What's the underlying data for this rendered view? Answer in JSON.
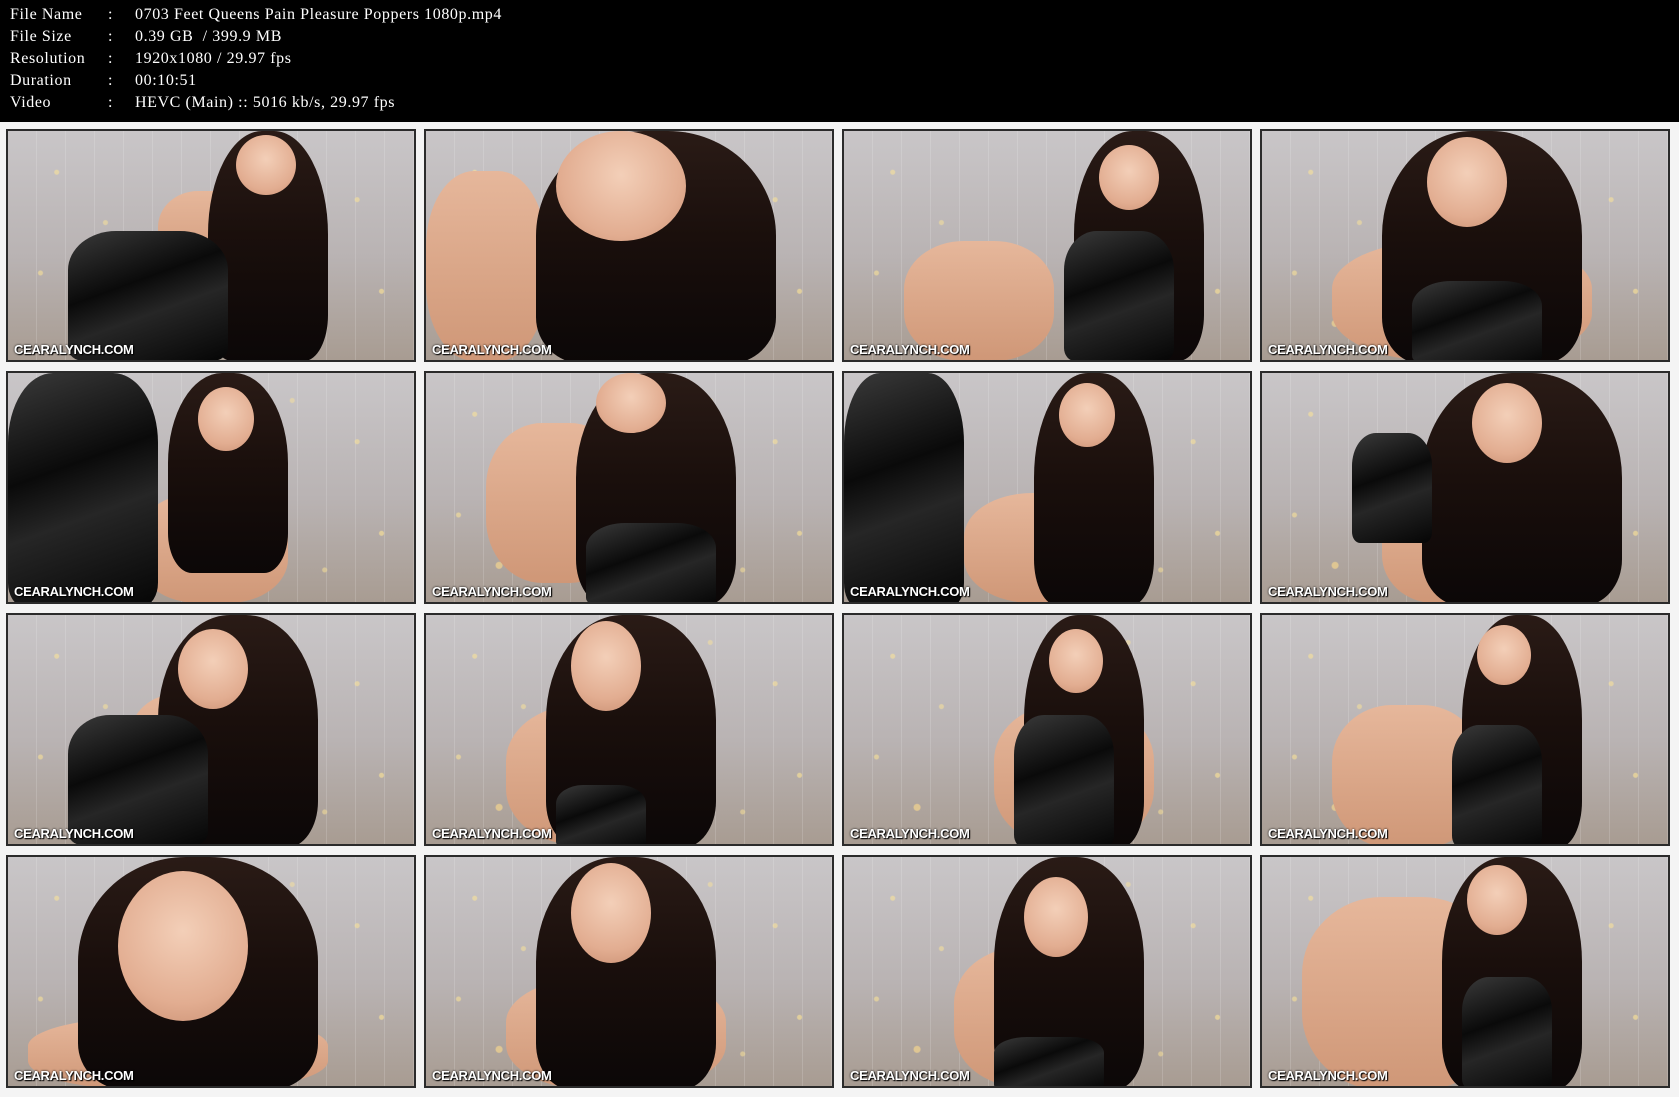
{
  "info": {
    "rows": [
      {
        "key": "File Name",
        "sep": ":",
        "value": "0703 Feet Queens Pain Pleasure Poppers 1080p.mp4"
      },
      {
        "key": "File Size",
        "sep": ":",
        "value": "0.39 GB  / 399.9 MB"
      },
      {
        "key": "Resolution",
        "sep": ":",
        "value": "1920x1080 / 29.97 fps"
      },
      {
        "key": "Duration",
        "sep": ":",
        "value": "00:10:51"
      },
      {
        "key": "Video",
        "sep": ":",
        "value": "HEVC (Main) :: 5016 kb/s, 29.97 fps"
      }
    ]
  },
  "thumbnails": {
    "watermark": "CEARALYNCH.COM",
    "count": 16
  },
  "colors": {
    "header_bg": "#000000",
    "header_text": "#ffffff",
    "sheet_bg": "#f4f4f4",
    "thumb_border": "#2b2b2b"
  }
}
